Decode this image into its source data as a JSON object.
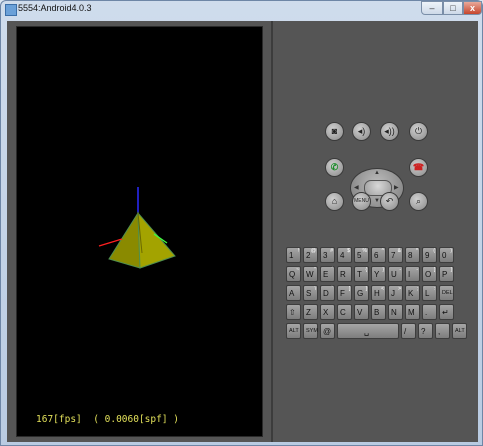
{
  "window": {
    "title": "5554:Android4.0.3",
    "buttons": {
      "minimize": "–",
      "maximize": "□",
      "close": "x"
    }
  },
  "screen": {
    "fps_text": "167[fps]  ( 0.0060[spf] )"
  },
  "controls": {
    "row1": [
      {
        "name": "camera-button",
        "icon": "camera-icon",
        "glyph": "◙"
      },
      {
        "name": "volume-down-button",
        "icon": "volume-down-icon",
        "glyph": "◂)"
      },
      {
        "name": "volume-up-button",
        "icon": "volume-up-icon",
        "glyph": "◂))"
      },
      {
        "name": "power-button",
        "icon": "power-icon",
        "glyph": "⏻"
      }
    ],
    "row2": [
      {
        "name": "call-button",
        "icon": "phone-call-icon",
        "glyph": "✆"
      },
      {
        "name": "end-call-button",
        "icon": "phone-end-icon",
        "glyph": "☎"
      }
    ],
    "row3": [
      {
        "name": "home-button",
        "icon": "home-icon",
        "glyph": "⌂"
      },
      {
        "name": "menu-button",
        "icon": "menu-icon",
        "glyph": "MENU"
      },
      {
        "name": "back-button",
        "icon": "back-icon",
        "glyph": "↶"
      },
      {
        "name": "search-button",
        "icon": "search-icon",
        "glyph": "⌕"
      }
    ]
  },
  "keyboard": {
    "row1": [
      [
        "1",
        "!"
      ],
      [
        "2",
        "@"
      ],
      [
        "3",
        "#"
      ],
      [
        "4",
        "$"
      ],
      [
        "5",
        "%"
      ],
      [
        "6",
        "^"
      ],
      [
        "7",
        "&"
      ],
      [
        "8",
        "*"
      ],
      [
        "9",
        "("
      ],
      [
        "0",
        ")"
      ]
    ],
    "row2": [
      [
        "Q",
        "~"
      ],
      [
        "W",
        "\""
      ],
      [
        "E",
        "´"
      ],
      [
        "R",
        ""
      ],
      [
        "T",
        "{"
      ],
      [
        "Y",
        "}"
      ],
      [
        "U",
        "-"
      ],
      [
        "I",
        "-"
      ],
      [
        "O",
        "["
      ],
      [
        "P",
        "]"
      ]
    ],
    "row3": [
      [
        "A",
        ""
      ],
      [
        "S",
        "\\"
      ],
      [
        "D",
        "`"
      ],
      [
        "F",
        "["
      ],
      [
        "G",
        "]"
      ],
      [
        "H",
        "<"
      ],
      [
        "J",
        ">"
      ],
      [
        "K",
        ";"
      ],
      [
        "L",
        ":"
      ],
      [
        "DEL",
        ""
      ]
    ],
    "row4": [
      [
        "⇧",
        ""
      ],
      [
        "Z",
        ""
      ],
      [
        "X",
        ""
      ],
      [
        "C",
        ""
      ],
      [
        "V",
        ""
      ],
      [
        "B",
        ""
      ],
      [
        "N",
        ""
      ],
      [
        "M",
        ""
      ],
      [
        ".",
        ""
      ],
      [
        "↵",
        ""
      ]
    ],
    "row5": [
      [
        "ALT",
        ""
      ],
      [
        "SYM",
        ""
      ],
      [
        "@",
        ""
      ],
      [
        "␣",
        ""
      ],
      [
        "/",
        ""
      ],
      [
        "?",
        ""
      ],
      [
        ",",
        ""
      ],
      [
        "ALT",
        ""
      ]
    ]
  }
}
